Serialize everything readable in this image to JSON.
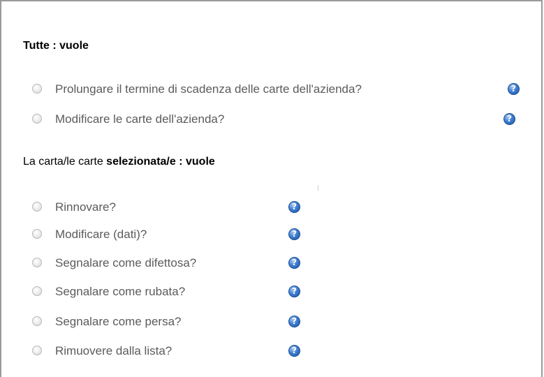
{
  "section_all": {
    "heading_bold": "Tutte : vuole",
    "options": [
      {
        "label": "Prolungare il termine di scadenza delle carte dell'azienda?",
        "help_icon": "help-icon"
      },
      {
        "label": "Modificare le carte dell'azienda?",
        "help_icon": "help-icon"
      }
    ]
  },
  "section_selected": {
    "heading_prefix": "La carta/le carte ",
    "heading_bold": "selezionata/e : vuole",
    "options": [
      {
        "label": "Rinnovare?",
        "help_icon": "help-icon"
      },
      {
        "label": "Modificare (dati)?",
        "help_icon": "help-icon"
      },
      {
        "label": "Segnalare come difettosa?",
        "help_icon": "help-icon"
      },
      {
        "label": "Segnalare come rubata?",
        "help_icon": "help-icon"
      },
      {
        "label": "Segnalare come persa?",
        "help_icon": "help-icon"
      },
      {
        "label": "Rimuovere dalla lista?",
        "help_icon": "help-icon"
      }
    ]
  },
  "help_glyph": "?",
  "colors": {
    "option_text": "#5b5b5b",
    "help_icon": "#2f6cc4",
    "border": "#9a9a9a"
  }
}
